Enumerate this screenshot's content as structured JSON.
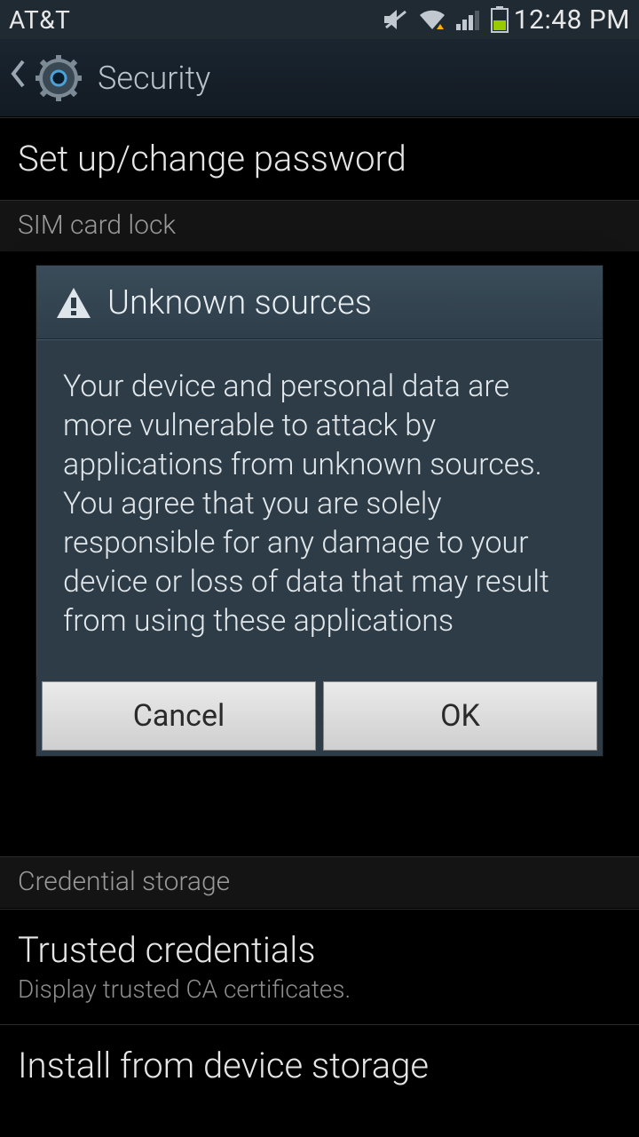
{
  "status": {
    "carrier": "AT&T",
    "time": "12:48 PM"
  },
  "header": {
    "title": "Security"
  },
  "list": {
    "password_item": "Set up/change password",
    "sim_section": "SIM card lock",
    "cred_section": "Credential storage",
    "trusted_title": "Trusted credentials",
    "trusted_sub": "Display trusted CA certificates.",
    "install_title": "Install from device storage"
  },
  "dialog": {
    "title": "Unknown sources",
    "body": "Your device and personal data are more vulnerable to attack by applications from unknown sources. You agree that you are solely responsible for any damage to your device or loss of data that may result from using these applications",
    "cancel": "Cancel",
    "ok": "OK"
  }
}
